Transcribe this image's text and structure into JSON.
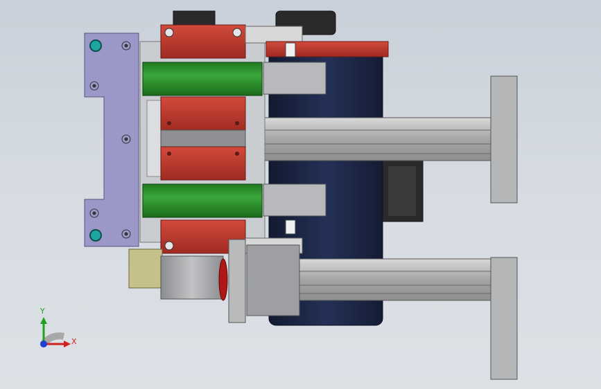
{
  "viewport": {
    "description_mode": "cad-3d-assembly-view",
    "colors": {
      "background_top": "#c9d0d9",
      "background_bottom": "#dde1e6",
      "bracket_purple": "#9b98c9",
      "roller_green": "#2e8f2e",
      "red_block": "#b8352b",
      "motor_navy": "#1c2540",
      "aluminum": "#a7a8aa",
      "gear_black": "#2a2a2a",
      "yellow_block": "#c6c08a",
      "teal_bolt": "#1ea6a0"
    }
  },
  "triad": {
    "x_label": "X",
    "y_label": "Y",
    "x_color": "#d22020",
    "y_color": "#20a020",
    "z_color": "#2040d0"
  }
}
